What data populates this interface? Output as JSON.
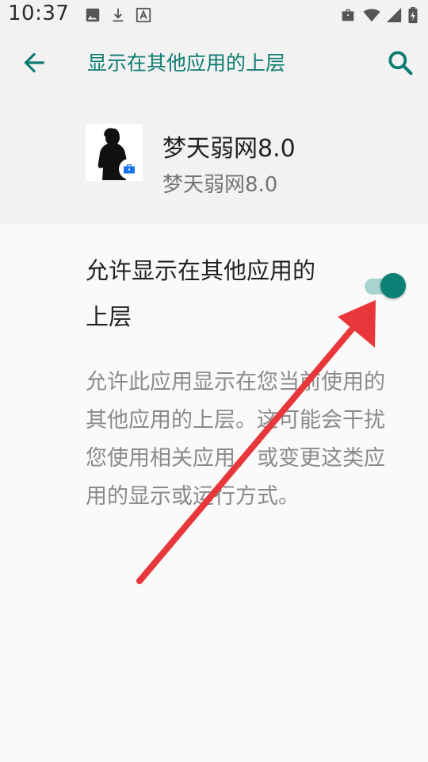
{
  "status_bar": {
    "time": "10:37",
    "icons_left": [
      "image-icon",
      "download-icon",
      "font-icon"
    ],
    "icons_right": [
      "briefcase-icon",
      "wifi-icon",
      "signal-icon",
      "battery-icon"
    ]
  },
  "toolbar": {
    "title": "显示在其他应用的上层",
    "back_icon": "arrow-back-icon",
    "search_icon": "search-icon",
    "accent_color": "#0c7b70"
  },
  "app": {
    "name": "梦天弱网8.0",
    "subtitle": "梦天弱网8.0",
    "icon": "silhouette-app-icon",
    "badge_icon": "work-profile-badge-icon"
  },
  "setting": {
    "label": "允许显示在其他应用的上层",
    "enabled": true,
    "description": "允许此应用显示在您当前使用的其他应用的上层。这可能会干扰您使用相关应用，或变更这类应用的显示或运行方式。"
  },
  "annotation": {
    "type": "red-arrow",
    "color": "#e8373a"
  }
}
